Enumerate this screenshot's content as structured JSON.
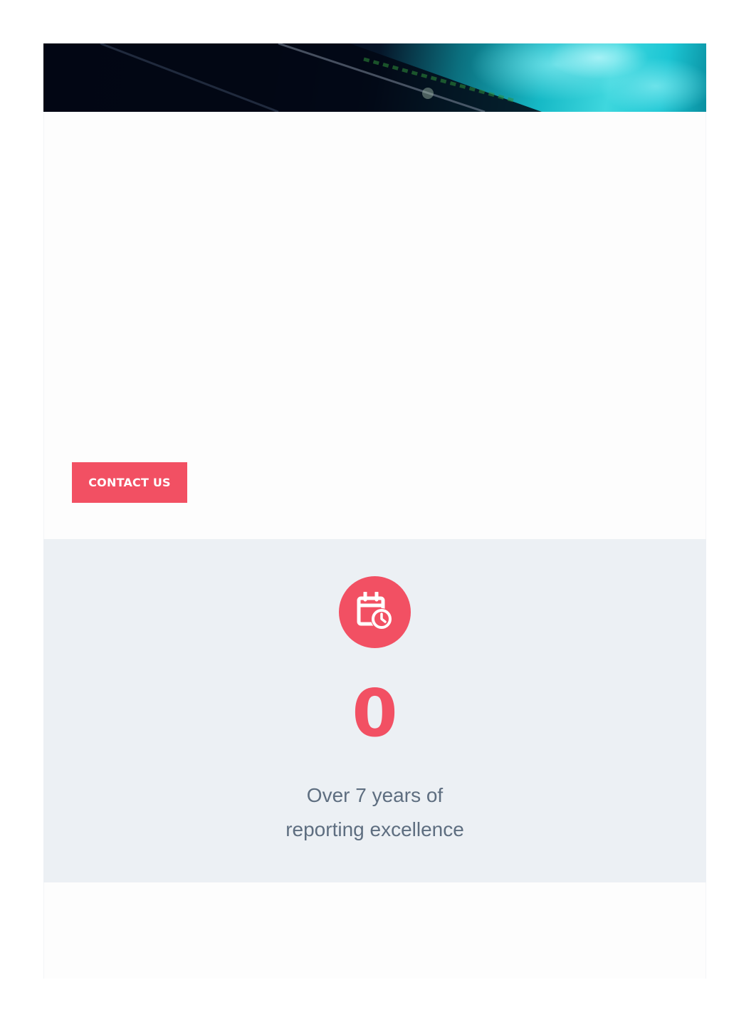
{
  "hero": {
    "image_name": "hero-banner-image"
  },
  "cta": {
    "contact_label": "CONTACT US"
  },
  "stat": {
    "icon": "calendar-clock-icon",
    "number": "0",
    "caption_line1": "Over 7 years of",
    "caption_line2": "reporting excellence"
  },
  "colors": {
    "accent": "#f25063",
    "stat_background": "#ecf0f4",
    "caption_text": "#5e6e80"
  }
}
